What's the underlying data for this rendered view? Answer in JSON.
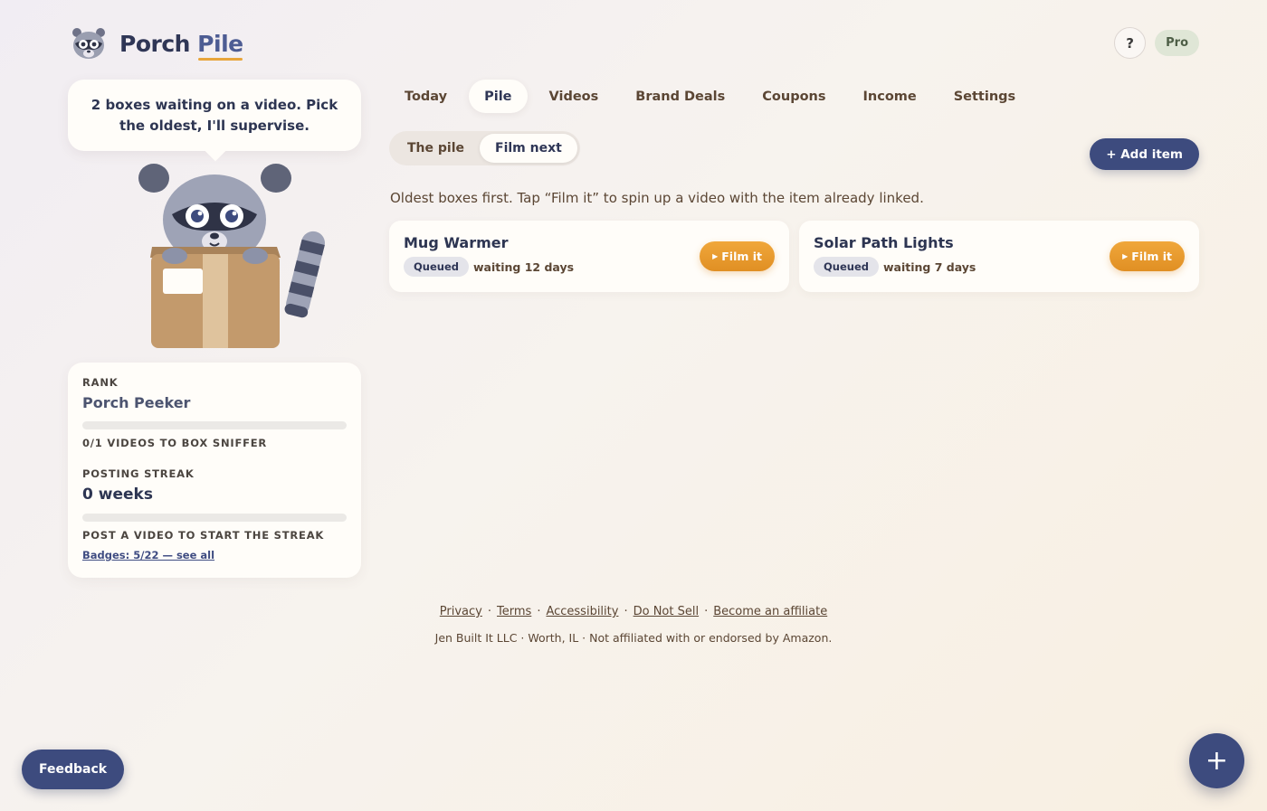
{
  "brand": {
    "name_part1": "Porch",
    "name_part2": "Pile"
  },
  "header": {
    "help_label": "?",
    "plan_badge": "Pro"
  },
  "mascot": {
    "speech": "2 boxes waiting on a video. Pick the oldest, I'll supervise."
  },
  "stats": {
    "rank_label": "RANK",
    "rank_name": "Porch Peeker",
    "rank_progress": 0,
    "rank_caption": "0/1 VIDEOS TO BOX SNIFFER",
    "streak_label": "POSTING STREAK",
    "streak_value": "0 weeks",
    "streak_progress": 0,
    "streak_caption": "POST A VIDEO TO START THE STREAK",
    "badges_link": "Badges: 5/22 — see all"
  },
  "nav": {
    "tabs": [
      {
        "label": "Today",
        "active": false
      },
      {
        "label": "Pile",
        "active": true
      },
      {
        "label": "Videos",
        "active": false
      },
      {
        "label": "Brand Deals",
        "active": false
      },
      {
        "label": "Coupons",
        "active": false
      },
      {
        "label": "Income",
        "active": false
      },
      {
        "label": "Settings",
        "active": false
      }
    ]
  },
  "segment": {
    "options": [
      {
        "label": "The pile",
        "active": false
      },
      {
        "label": "Film next",
        "active": true
      }
    ]
  },
  "actions": {
    "add_item": "+ Add item"
  },
  "hint": "Oldest boxes first. Tap “Film it” to spin up a video with the item already linked.",
  "items": [
    {
      "name": "Mug Warmer",
      "status": "Queued",
      "waiting": "waiting 12 days",
      "action": "Film it"
    },
    {
      "name": "Solar Path Lights",
      "status": "Queued",
      "waiting": "waiting 7 days",
      "action": "Film it"
    }
  ],
  "footer": {
    "links": [
      "Privacy",
      "Terms",
      "Accessibility",
      "Do Not Sell",
      "Become an affiliate"
    ],
    "copy": "Jen Built It LLC · Worth, IL · Not affiliated with or endorsed by Amazon."
  },
  "feedback": "Feedback",
  "fab": "+",
  "colors": {
    "navy": "#3d4b7e",
    "accent_orange": "#e8a53b",
    "text_brown": "#5b4634"
  },
  "icons": {
    "logo": "raccoon-logo-icon",
    "play": "play-triangle-icon",
    "mascot": "raccoon-with-box-illustration"
  }
}
